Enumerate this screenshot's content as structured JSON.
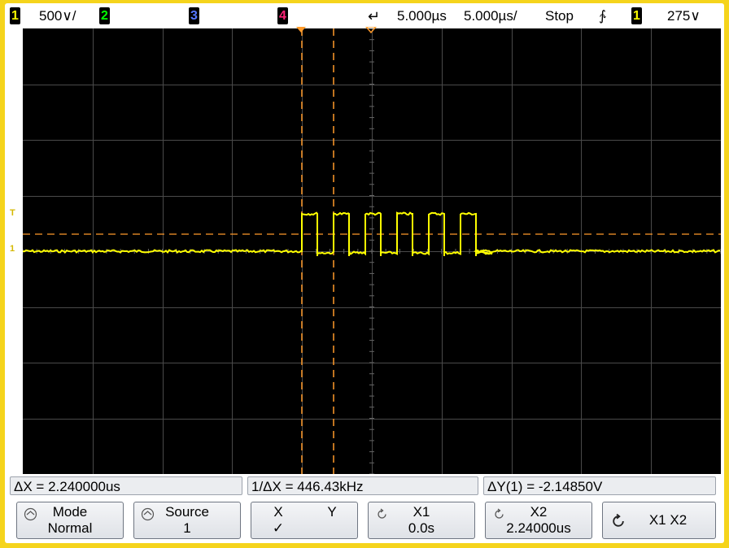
{
  "topbar": {
    "ch1_label": "1",
    "ch1_scale": "500∨/",
    "ch2_label": "2",
    "ch3_label": "3",
    "ch4_label": "4",
    "trig_delay": "5.000µs",
    "timebase": "5.000µs/",
    "run_state": "Stop",
    "trig_slope": "∱",
    "trig_source": "1",
    "trig_level": "275∨"
  },
  "measurements": {
    "delta_x": "ΔX = 2.240000us",
    "inv_delta_x": "1/ΔX = 446.43kHz",
    "delta_y": "ΔY(1) = -2.14850V"
  },
  "softkeys": {
    "mode_title": "Mode",
    "mode_value": "Normal",
    "source_title": "Source",
    "source_value": "1",
    "xy_x": "X",
    "xy_y": "Y",
    "xy_check": "✓",
    "x1_title": "X1",
    "x1_value": "0.0s",
    "x2_title": "X2",
    "x2_value": "2.24000us",
    "x1x2_title": "X1 X2"
  },
  "markers": {
    "trigger_marker": "T",
    "ground_marker": "1"
  },
  "colors": {
    "ch1": "#ffff00",
    "ch2": "#00ff00",
    "ch3": "#3355ff",
    "ch4": "#ff2277",
    "cursor": "#ff9a2a",
    "grid": "#4a4a4a",
    "frame": "#f5d41c"
  }
}
